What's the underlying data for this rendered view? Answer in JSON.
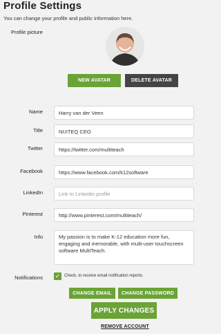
{
  "page": {
    "title": "Profile Settings",
    "subtitle": "You can change your profile and public information here."
  },
  "avatar": {
    "label": "Profile picture",
    "new_button": "NEW AVATAR",
    "delete_button": "DELETE AVATAR"
  },
  "fields": {
    "name": {
      "label": "Name",
      "value": "Harry van der Veen"
    },
    "title": {
      "label": "Title",
      "value": "NUITEQ CEO"
    },
    "twitter": {
      "label": "Twitter",
      "value": "https://twitter.com/multiteach"
    },
    "facebook": {
      "label": "Facebook",
      "value": "https://www.facebook.com/k12software"
    },
    "linkedin": {
      "label": "LinkedIn",
      "value": "",
      "placeholder": "Link to Linkedin profile"
    },
    "pinterest": {
      "label": "Pinterest",
      "value": "http://www.pinterest.com/multiteach/"
    },
    "info": {
      "label": "Info",
      "value": "My passion is to make K-12 education more fun, engaging and memorable, with multi-user touchscreen software MultiTeach."
    }
  },
  "notifications": {
    "label": "Notifications",
    "checked": true,
    "text": "Check, to receive email notification reports."
  },
  "actions": {
    "change_email": "CHANGE EMAIL",
    "change_password": "CHANGE PASSWORD",
    "apply": "APPLY CHANGES",
    "remove": "REMOVE ACCOUNT"
  },
  "colors": {
    "accent": "#6aa336",
    "dark_button": "#444444",
    "background": "#f2f2f2"
  }
}
